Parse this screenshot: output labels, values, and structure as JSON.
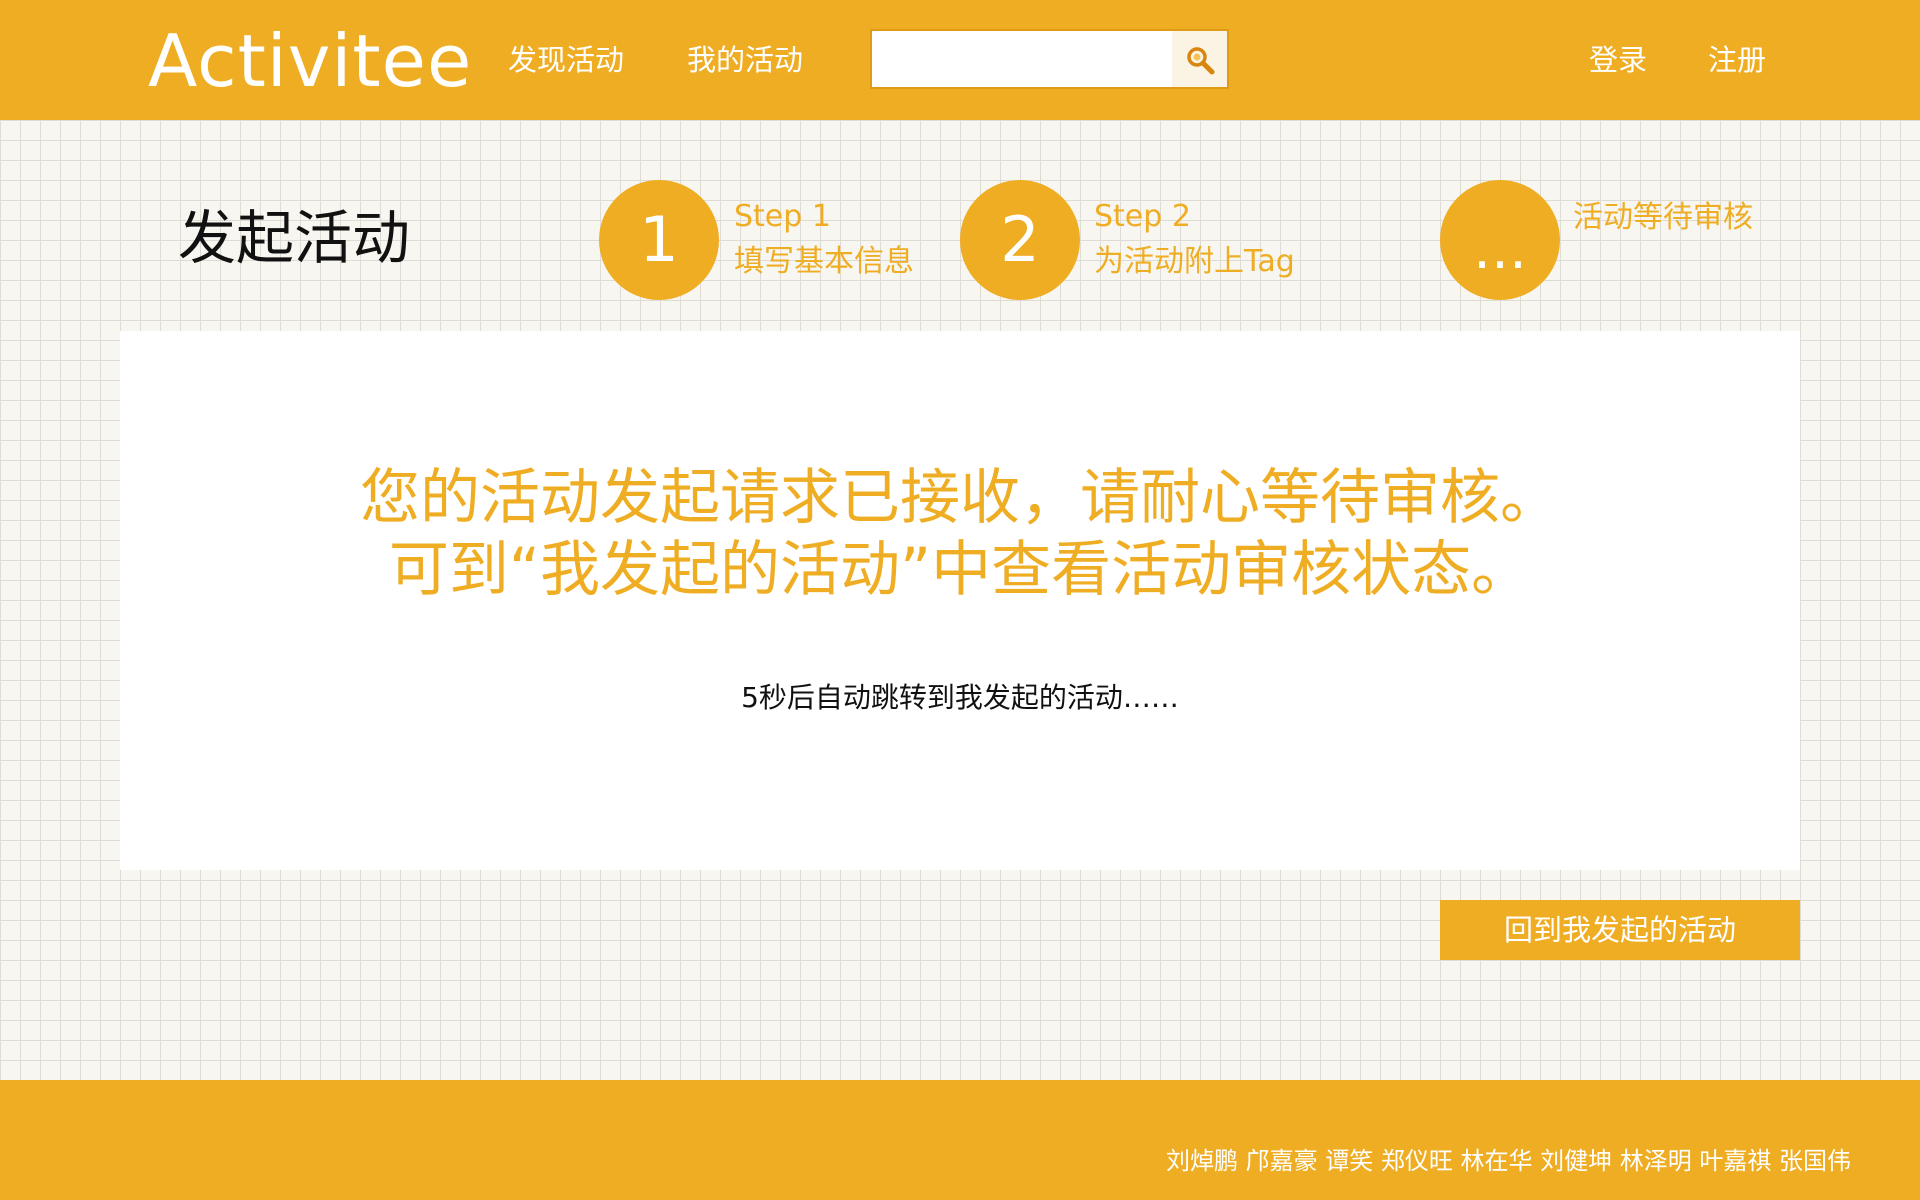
{
  "header": {
    "logo": "Activitee",
    "nav": [
      {
        "label": "发现活动"
      },
      {
        "label": "我的活动"
      }
    ],
    "search": {
      "placeholder": "",
      "icon": "search-icon"
    },
    "auth": {
      "login": "登录",
      "register": "注册"
    }
  },
  "page": {
    "title": "发起活动",
    "steps": [
      {
        "badge": "1",
        "line1": "Step 1",
        "line2": "填写基本信息"
      },
      {
        "badge": "2",
        "line1": "Step 2",
        "line2": "为活动附上Tag"
      },
      {
        "badge": "…",
        "line1": "活动等待审核",
        "line2": ""
      }
    ]
  },
  "panel": {
    "message_line1": "您的活动发起请求已接收，请耐心等待审核。",
    "message_line2": "可到“我发起的活动”中查看活动审核状态。",
    "redirect_note": "5秒后自动跳转到我发起的活动……"
  },
  "back_button": "回到我发起的活动",
  "footer": {
    "credits": "刘焯鹏 邝嘉豪 谭笑 郑仪旺 林在华 刘健坤 林泽明 叶嘉祺 张国伟"
  },
  "colors": {
    "accent": "#efad24",
    "text_dark": "#111111",
    "background": "#f8f6f0"
  }
}
